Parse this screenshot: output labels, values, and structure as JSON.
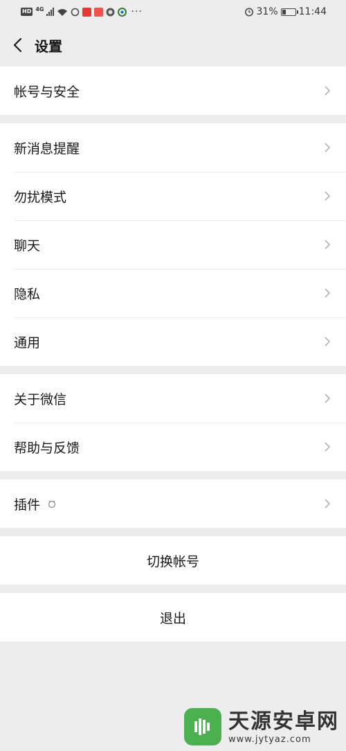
{
  "status_bar": {
    "hd_label": "HD",
    "network_label": "4G",
    "dots": "···",
    "battery_percent": 31,
    "battery_label": "31%",
    "time": "11:44"
  },
  "nav": {
    "title": "设置"
  },
  "groups": [
    {
      "items": [
        {
          "label": "帐号与安全"
        }
      ]
    },
    {
      "items": [
        {
          "label": "新消息提醒"
        },
        {
          "label": "勿扰模式"
        },
        {
          "label": "聊天"
        },
        {
          "label": "隐私"
        },
        {
          "label": "通用"
        }
      ]
    },
    {
      "items": [
        {
          "label": "关于微信"
        },
        {
          "label": "帮助与反馈"
        }
      ]
    },
    {
      "items": [
        {
          "label": "插件"
        }
      ]
    }
  ],
  "actions": {
    "switch_account": "切换帐号",
    "logout": "退出"
  },
  "watermark": {
    "title": "天源安卓网",
    "url": "www.jytyaz.com"
  },
  "colors": {
    "background": "#ededed",
    "card": "#ffffff",
    "text": "#191919",
    "chevron": "#b2b2b2"
  }
}
